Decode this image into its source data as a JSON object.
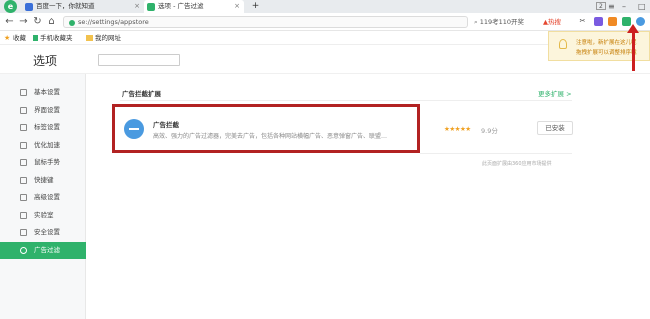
{
  "browser": {
    "tabs": [
      {
        "label": "百度一下，你就知道",
        "icon": "paw-icon"
      },
      {
        "label": "选项 - 广告过滤",
        "icon": "settings-icon"
      }
    ],
    "new_tab_label": "+",
    "window_badge": "2",
    "url": "se://settings/appstore",
    "search_hint": "119考110开奖",
    "hot_label": "热搜",
    "bookmarks": [
      {
        "label": "收藏",
        "icon": "star-icon"
      },
      {
        "label": "手机收藏夹",
        "icon": "phone-icon"
      },
      {
        "label": "我的网址",
        "icon": "folder-icon"
      }
    ],
    "tooltip_lines": [
      "注意啦，新扩展在这儿呢",
      "拖拽扩展可以调整排序哦"
    ]
  },
  "settings": {
    "title": "选项",
    "sidebar": [
      {
        "label": "基本设置",
        "icon": "gear-icon"
      },
      {
        "label": "界面设置",
        "icon": "layout-icon"
      },
      {
        "label": "标签设置",
        "icon": "tag-icon"
      },
      {
        "label": "优化加速",
        "icon": "rocket-icon"
      },
      {
        "label": "鼠标手势",
        "icon": "mouse-icon"
      },
      {
        "label": "快捷键",
        "icon": "keyboard-icon"
      },
      {
        "label": "高级设置",
        "icon": "advanced-icon"
      },
      {
        "label": "实验室",
        "icon": "lab-icon"
      },
      {
        "label": "安全设置",
        "icon": "shield-icon"
      },
      {
        "label": "广告过滤",
        "icon": "block-icon",
        "active": true
      }
    ],
    "section_title": "广告拦截扩展",
    "more_link": "更多扩展 >",
    "extension": {
      "name": "广告拦截",
      "description": "高效、强力的广告过滤器，完美去广告，包括各种网站横幅广告、恶意弹窗广告、联盟…",
      "rating": 4.5,
      "stars": "★★★★★",
      "score": "9.9分",
      "button": "已安装"
    },
    "footnote": "此页面扩展由360应用市场提供"
  }
}
